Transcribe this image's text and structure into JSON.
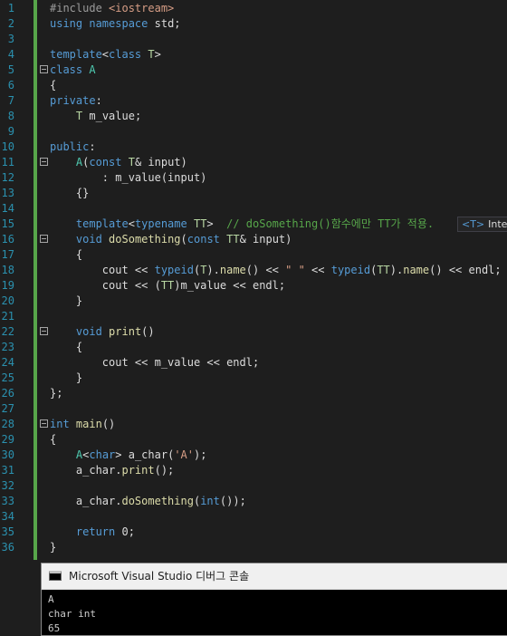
{
  "colors": {
    "background": "#1e1e1e",
    "line_number": "#2b91af",
    "keyword": "#569cd6",
    "type": "#4ec9b0",
    "string": "#d69d85",
    "comment": "#57a64a",
    "preprocessor": "#9b9b9b",
    "template_param": "#b8d7a3",
    "function": "#dcdcaa",
    "text": "#dcdcdc"
  },
  "editor": {
    "lines": [
      {
        "num": "1",
        "fold": false,
        "tokens": [
          {
            "t": "#include ",
            "c": "preproc"
          },
          {
            "t": "<iostream>",
            "c": "string"
          }
        ]
      },
      {
        "num": "2",
        "fold": false,
        "tokens": [
          {
            "t": "using",
            "c": "keyword"
          },
          {
            "t": " "
          },
          {
            "t": "namespace",
            "c": "keyword"
          },
          {
            "t": " std;"
          }
        ]
      },
      {
        "num": "3",
        "fold": false,
        "tokens": []
      },
      {
        "num": "4",
        "fold": false,
        "tokens": [
          {
            "t": "template",
            "c": "keyword"
          },
          {
            "t": "<"
          },
          {
            "t": "class",
            "c": "keyword"
          },
          {
            "t": " "
          },
          {
            "t": "T",
            "c": "tparam"
          },
          {
            "t": ">"
          }
        ]
      },
      {
        "num": "5",
        "fold": true,
        "tokens": [
          {
            "t": "class",
            "c": "keyword"
          },
          {
            "t": " "
          },
          {
            "t": "A",
            "c": "type"
          }
        ]
      },
      {
        "num": "6",
        "fold": false,
        "tokens": [
          {
            "t": "{"
          }
        ]
      },
      {
        "num": "7",
        "fold": false,
        "tokens": [
          {
            "t": "private",
            "c": "keyword"
          },
          {
            "t": ":"
          }
        ]
      },
      {
        "num": "8",
        "fold": false,
        "tokens": [
          {
            "t": "    "
          },
          {
            "t": "T",
            "c": "tparam"
          },
          {
            "t": " m_value;"
          }
        ]
      },
      {
        "num": "9",
        "fold": false,
        "tokens": []
      },
      {
        "num": "10",
        "fold": false,
        "tokens": [
          {
            "t": "public",
            "c": "keyword"
          },
          {
            "t": ":"
          }
        ]
      },
      {
        "num": "11",
        "fold": true,
        "tokens": [
          {
            "t": "    "
          },
          {
            "t": "A",
            "c": "type"
          },
          {
            "t": "("
          },
          {
            "t": "const",
            "c": "keyword"
          },
          {
            "t": " "
          },
          {
            "t": "T",
            "c": "tparam"
          },
          {
            "t": "& input)"
          }
        ]
      },
      {
        "num": "12",
        "fold": false,
        "tokens": [
          {
            "t": "        : m_value(input)"
          }
        ]
      },
      {
        "num": "13",
        "fold": false,
        "tokens": [
          {
            "t": "    {}"
          }
        ]
      },
      {
        "num": "14",
        "fold": false,
        "tokens": []
      },
      {
        "num": "15",
        "fold": false,
        "tokens": [
          {
            "t": "    "
          },
          {
            "t": "template",
            "c": "keyword"
          },
          {
            "t": "<"
          },
          {
            "t": "typename",
            "c": "keyword"
          },
          {
            "t": " "
          },
          {
            "t": "TT",
            "c": "tparam"
          },
          {
            "t": ">  "
          },
          {
            "t": "// doSomething()함수에만 TT가 적용.",
            "c": "comment"
          }
        ]
      },
      {
        "num": "16",
        "fold": true,
        "tokens": [
          {
            "t": "    "
          },
          {
            "t": "void",
            "c": "keyword"
          },
          {
            "t": " "
          },
          {
            "t": "doSomething",
            "c": "func"
          },
          {
            "t": "("
          },
          {
            "t": "const",
            "c": "keyword"
          },
          {
            "t": " "
          },
          {
            "t": "TT",
            "c": "tparam"
          },
          {
            "t": "& input)"
          }
        ]
      },
      {
        "num": "17",
        "fold": false,
        "tokens": [
          {
            "t": "    {"
          }
        ]
      },
      {
        "num": "18",
        "fold": false,
        "tokens": [
          {
            "t": "        cout << "
          },
          {
            "t": "typeid",
            "c": "keyword"
          },
          {
            "t": "("
          },
          {
            "t": "T",
            "c": "tparam"
          },
          {
            "t": ")."
          },
          {
            "t": "name",
            "c": "func"
          },
          {
            "t": "() << "
          },
          {
            "t": "\" \"",
            "c": "string"
          },
          {
            "t": " << "
          },
          {
            "t": "typeid",
            "c": "keyword"
          },
          {
            "t": "("
          },
          {
            "t": "TT",
            "c": "tparam"
          },
          {
            "t": ")."
          },
          {
            "t": "name",
            "c": "func"
          },
          {
            "t": "() << endl;"
          }
        ]
      },
      {
        "num": "19",
        "fold": false,
        "tokens": [
          {
            "t": "        cout << ("
          },
          {
            "t": "TT",
            "c": "tparam"
          },
          {
            "t": ")m_value << endl;"
          }
        ]
      },
      {
        "num": "20",
        "fold": false,
        "tokens": [
          {
            "t": "    }"
          }
        ]
      },
      {
        "num": "21",
        "fold": false,
        "tokens": []
      },
      {
        "num": "22",
        "fold": true,
        "tokens": [
          {
            "t": "    "
          },
          {
            "t": "void",
            "c": "keyword"
          },
          {
            "t": " "
          },
          {
            "t": "print",
            "c": "func"
          },
          {
            "t": "()"
          }
        ]
      },
      {
        "num": "23",
        "fold": false,
        "tokens": [
          {
            "t": "    {"
          }
        ]
      },
      {
        "num": "24",
        "fold": false,
        "tokens": [
          {
            "t": "        cout << m_value << endl;"
          }
        ]
      },
      {
        "num": "25",
        "fold": false,
        "tokens": [
          {
            "t": "    }"
          }
        ]
      },
      {
        "num": "26",
        "fold": false,
        "tokens": [
          {
            "t": "};"
          }
        ]
      },
      {
        "num": "27",
        "fold": false,
        "tokens": []
      },
      {
        "num": "28",
        "fold": true,
        "tokens": [
          {
            "t": "int",
            "c": "keyword"
          },
          {
            "t": " "
          },
          {
            "t": "main",
            "c": "func"
          },
          {
            "t": "()"
          }
        ]
      },
      {
        "num": "29",
        "fold": false,
        "tokens": [
          {
            "t": "{"
          }
        ]
      },
      {
        "num": "30",
        "fold": false,
        "tokens": [
          {
            "t": "    "
          },
          {
            "t": "A",
            "c": "type"
          },
          {
            "t": "<"
          },
          {
            "t": "char",
            "c": "keyword"
          },
          {
            "t": "> a_char("
          },
          {
            "t": "'A'",
            "c": "string"
          },
          {
            "t": ");"
          }
        ]
      },
      {
        "num": "31",
        "fold": false,
        "tokens": [
          {
            "t": "    a_char."
          },
          {
            "t": "print",
            "c": "func"
          },
          {
            "t": "();"
          }
        ]
      },
      {
        "num": "32",
        "fold": false,
        "tokens": []
      },
      {
        "num": "33",
        "fold": false,
        "tokens": [
          {
            "t": "    a_char."
          },
          {
            "t": "doSomething",
            "c": "func"
          },
          {
            "t": "("
          },
          {
            "t": "int",
            "c": "keyword"
          },
          {
            "t": "());"
          }
        ]
      },
      {
        "num": "34",
        "fold": false,
        "tokens": []
      },
      {
        "num": "35",
        "fold": false,
        "tokens": [
          {
            "t": "    "
          },
          {
            "t": "return",
            "c": "keyword"
          },
          {
            "t": " 0;"
          }
        ]
      },
      {
        "num": "36",
        "fold": false,
        "tokens": [
          {
            "t": "}"
          }
        ]
      }
    ]
  },
  "tooltip": {
    "tag": "<T>",
    "text": "Intel"
  },
  "console": {
    "title": "Microsoft Visual Studio 디버그 콘솔",
    "output": "A\nchar int\n65"
  }
}
